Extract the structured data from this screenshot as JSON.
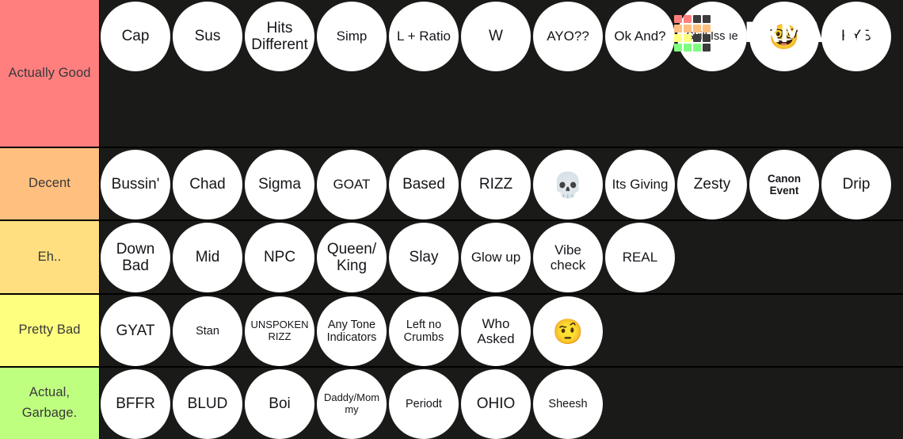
{
  "app": {
    "name": "TierMaker",
    "logo_text": "TiERMAKER",
    "background_color": "#1a1b18",
    "logo_grid_colors": [
      "#ff7f7f",
      "#ff7f7f",
      "#3c3c3c",
      "#3c3c3c",
      "#ffbf7f",
      "#ffbf7f",
      "#ffbf7f",
      "#ffbf7f",
      "#ffff7f",
      "#ffff7f",
      "#3c3c3c",
      "#3c3c3c",
      "#7fff7f",
      "#7fff7f",
      "#7fff7f",
      "#3c3c3c"
    ]
  },
  "tiers": [
    {
      "label": "Actually Good",
      "color": "#ff7f7f",
      "items": [
        {
          "text": "Cap",
          "size": "lg"
        },
        {
          "text": "Sus",
          "size": "lg"
        },
        {
          "text": "Hits Different",
          "size": "lg"
        },
        {
          "text": "Simp",
          "size": "md"
        },
        {
          "text": "L + Ratio",
          "size": "md"
        },
        {
          "text": "W",
          "size": "lg"
        },
        {
          "text": "AYO??",
          "size": "md"
        },
        {
          "text": "Ok And?",
          "size": "md"
        },
        {
          "text": "Skill Issue",
          "size": "sm"
        },
        {
          "text": "🤓",
          "size": "emoji"
        },
        {
          "text": "KYS",
          "size": "lg"
        }
      ]
    },
    {
      "label": "Decent",
      "color": "#ffbf7f",
      "items": [
        {
          "text": "Bussin'",
          "size": "lg"
        },
        {
          "text": "Chad",
          "size": "lg"
        },
        {
          "text": "Sigma",
          "size": "lg"
        },
        {
          "text": "GOAT",
          "size": "md"
        },
        {
          "text": "Based",
          "size": "lg"
        },
        {
          "text": "RIZZ",
          "size": "lg"
        },
        {
          "text": "💀",
          "size": "emoji"
        },
        {
          "text": "Its Giving",
          "size": "md"
        },
        {
          "text": "Zesty",
          "size": "lg"
        },
        {
          "text": "Canon Event",
          "size": "bold"
        },
        {
          "text": "Drip",
          "size": "lg"
        }
      ]
    },
    {
      "label": "Eh..",
      "color": "#ffdf80",
      "items": [
        {
          "text": "Down Bad",
          "size": "lg"
        },
        {
          "text": "Mid",
          "size": "lg"
        },
        {
          "text": "NPC",
          "size": "lg"
        },
        {
          "text": "Queen/ King",
          "size": "lg"
        },
        {
          "text": "Slay",
          "size": "lg"
        },
        {
          "text": "Glow up",
          "size": "md"
        },
        {
          "text": "Vibe check",
          "size": "md"
        },
        {
          "text": "REAL",
          "size": "md"
        }
      ]
    },
    {
      "label": "Pretty Bad",
      "color": "#ffff7f",
      "items": [
        {
          "text": "GYAT",
          "size": "lg"
        },
        {
          "text": "Stan",
          "size": "sm"
        },
        {
          "text": "UNSPOKEN RIZZ",
          "size": "xs"
        },
        {
          "text": "Any Tone Indicators",
          "size": "sm"
        },
        {
          "text": "Left no Crumbs",
          "size": "sm"
        },
        {
          "text": "Who Asked",
          "size": "md"
        },
        {
          "text": "🤨",
          "size": "emoji"
        }
      ]
    },
    {
      "label": "Actual, Garbage.",
      "color": "#bfff7f",
      "items": [
        {
          "text": "BFFR",
          "size": "lg"
        },
        {
          "text": "BLUD",
          "size": "lg"
        },
        {
          "text": "Boi",
          "size": "lg"
        },
        {
          "text": "Daddy/Mommy",
          "size": "xs"
        },
        {
          "text": "Periodt",
          "size": "sm"
        },
        {
          "text": "OHIO",
          "size": "lg"
        },
        {
          "text": "Sheesh",
          "size": "sm"
        }
      ]
    }
  ]
}
